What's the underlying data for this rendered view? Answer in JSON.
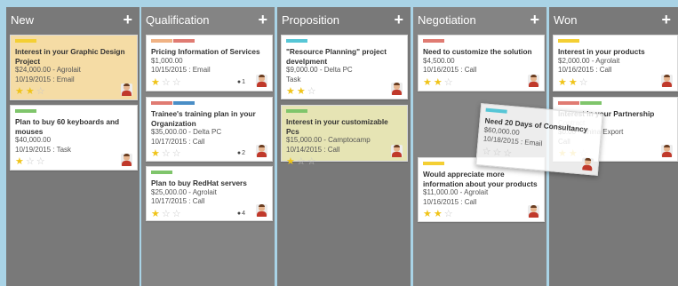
{
  "colors": {
    "tag_yellow": "#f4cf33",
    "tag_green": "#7fc56b",
    "tag_red": "#e07b72",
    "tag_orange": "#f0b284",
    "tag_blue": "#4a8ec6",
    "tag_cyan": "#56c6d6",
    "star_on": "#f0c419"
  },
  "columns": [
    {
      "title": "New",
      "add_icon": "plus-icon",
      "add_glyph": "+"
    },
    {
      "title": "Qualification",
      "add_icon": "plus-icon",
      "add_glyph": "+"
    },
    {
      "title": "Proposition",
      "add_icon": "plus-icon",
      "add_glyph": "+"
    },
    {
      "title": "Negotiation",
      "add_icon": "plus-icon",
      "add_glyph": "+"
    },
    {
      "title": "Won",
      "add_icon": "plus-icon",
      "add_glyph": "+"
    }
  ],
  "cards": {
    "new_1": {
      "title": "Interest in your Graphic Design Project",
      "amount": "$24,000.00 - Agrolait",
      "activity": "10/19/2015 : Email",
      "stars": 2
    },
    "new_2": {
      "title": "Plan to buy 60 keyboards and mouses",
      "amount": "$40,000.00",
      "activity": "10/19/2015 : Task",
      "stars": 1
    },
    "qual_1": {
      "title": "Pricing Information of Services",
      "amount": "$1,000.00",
      "activity": "10/15/2015 : Email",
      "stars": 1,
      "messages": "1"
    },
    "qual_2": {
      "title": "Trainee's training plan in your Organization",
      "amount": "$35,000.00 - Delta PC",
      "activity": "10/17/2015 : Call",
      "stars": 1,
      "messages": "2"
    },
    "qual_3": {
      "title": "Plan to buy RedHat servers",
      "amount": "$25,000.00 - Agrolait",
      "activity": "10/17/2015 : Call",
      "stars": 1,
      "messages": "4"
    },
    "prop_1": {
      "title": "\"Resource Planning\" project develpment",
      "amount": "$9,000.00 - Delta PC",
      "activity": "Task",
      "stars": 2
    },
    "prop_2": {
      "title": "Interest in your customizable Pcs",
      "amount": "$15,000.00 - Camptocamp",
      "activity": "10/14/2015 : Call",
      "stars": 1
    },
    "nego_1": {
      "title": "Need to customize the solution",
      "amount": "$4,500.00",
      "activity": "10/16/2015 : Call",
      "stars": 2
    },
    "nego_2": {
      "title": "Would appreciate more information about your products",
      "amount": "$11,000.00 - Agrolait",
      "activity": "10/16/2015 : Call",
      "stars": 2
    },
    "won_1": {
      "title": "Interest in your products",
      "amount": "$2,000.00 - Agrolait",
      "activity": "10/16/2015 : Call",
      "stars": 2
    },
    "won_2": {
      "title": "Interest in your Partnership",
      "amount_part": "Contract",
      "amount": "$0.00 - China Export",
      "activity": "Call",
      "stars": 2
    },
    "dragged": {
      "title": "Need 20 Days of Consultancy",
      "amount": "$60,000.00",
      "activity": "10/18/2015 : Email",
      "stars": 0
    }
  },
  "icons": {
    "star_on": "★",
    "star_off": "☆",
    "message": "comment-icon",
    "avatar": "user-avatar"
  }
}
